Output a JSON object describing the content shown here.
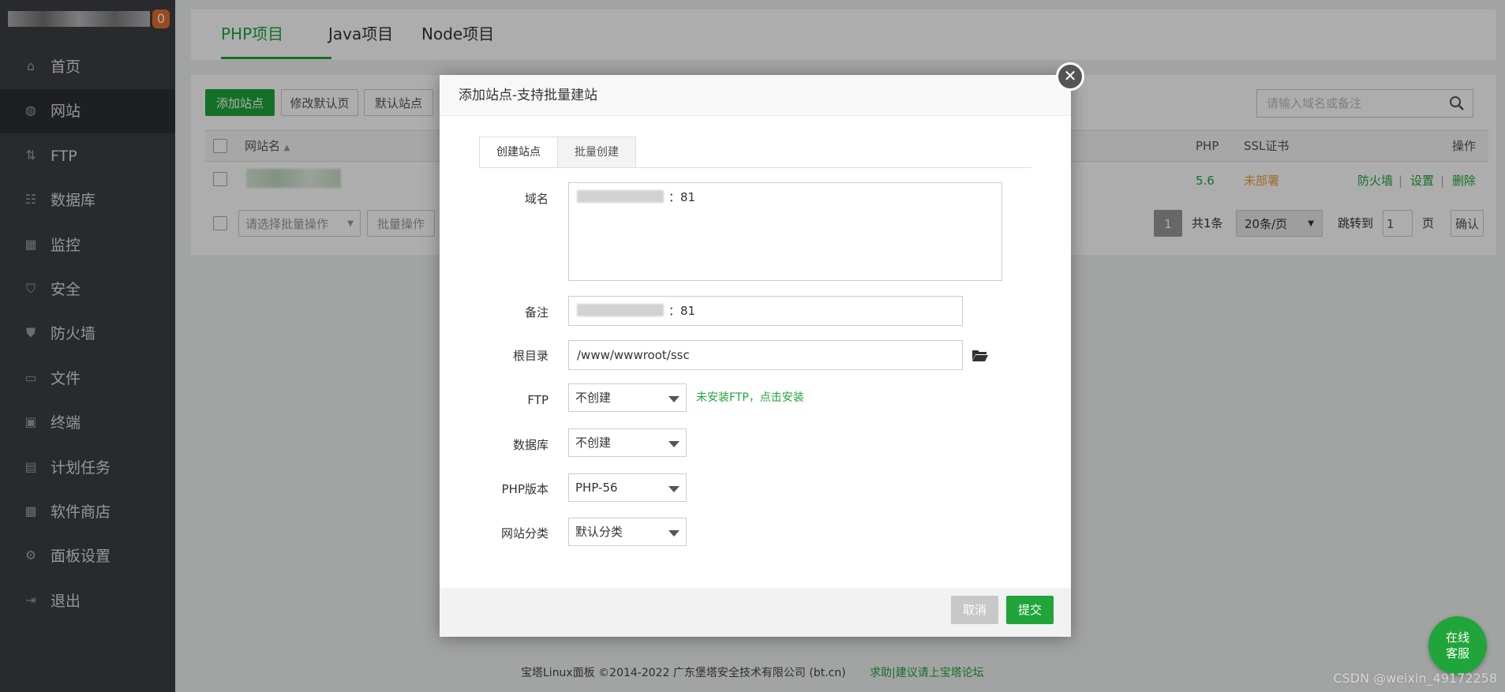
{
  "sidebar": {
    "badge": "0",
    "items": [
      {
        "label": "首页",
        "icon": "home-icon",
        "glyph": "⌂"
      },
      {
        "label": "网站",
        "icon": "globe-icon",
        "glyph": "◍"
      },
      {
        "label": "FTP",
        "icon": "ftp-icon",
        "glyph": "⇅"
      },
      {
        "label": "数据库",
        "icon": "database-icon",
        "glyph": "☷"
      },
      {
        "label": "监控",
        "icon": "monitor-icon",
        "glyph": "▦"
      },
      {
        "label": "安全",
        "icon": "shield-check-icon",
        "glyph": "⛉"
      },
      {
        "label": "防火墙",
        "icon": "firewall-icon",
        "glyph": "⛊"
      },
      {
        "label": "文件",
        "icon": "folder-icon",
        "glyph": "▭"
      },
      {
        "label": "终端",
        "icon": "terminal-icon",
        "glyph": "▣"
      },
      {
        "label": "计划任务",
        "icon": "calendar-icon",
        "glyph": "▤"
      },
      {
        "label": "软件商店",
        "icon": "apps-icon",
        "glyph": "▩"
      },
      {
        "label": "面板设置",
        "icon": "gear-icon",
        "glyph": "⚙"
      },
      {
        "label": "退出",
        "icon": "logout-icon",
        "glyph": "⇥"
      }
    ]
  },
  "project_tabs": [
    {
      "label": "PHP项目"
    },
    {
      "label": "Java项目"
    },
    {
      "label": "Node项目"
    }
  ],
  "toolbar": {
    "add_site": "添加站点",
    "edit_default_page": "修改默认页",
    "default_site": "默认站点",
    "search_placeholder": "请输入域名或备注"
  },
  "table": {
    "headers": {
      "name": "网站名",
      "php": "PHP",
      "ssl": "SSL证书",
      "actions": "操作"
    },
    "rows": [
      {
        "php": "5.6",
        "ssl": "未部署",
        "actions": [
          "防火墙",
          "设置",
          "删除"
        ],
        "sep": "|"
      }
    ]
  },
  "bulk": {
    "select_placeholder": "请选择批量操作",
    "apply": "批量操作"
  },
  "pagination": {
    "current": "1",
    "total": "共1条",
    "per_page": "20条/页",
    "jump_label": "跳转到",
    "jump_value": "1",
    "page_unit": "页",
    "confirm": "确认"
  },
  "modal": {
    "title": "添加站点-支持批量建站",
    "tabs": [
      "创建站点",
      "批量创建"
    ],
    "fields": {
      "domain_label": "域名",
      "domain_value": "：81",
      "note_label": "备注",
      "note_value": "：81",
      "root_label": "根目录",
      "root_value": "/www/wwwroot/ssc",
      "ftp_label": "FTP",
      "ftp_value": "不创建",
      "ftp_hint": "未安装FTP，点击安装",
      "db_label": "数据库",
      "db_value": "不创建",
      "php_label": "PHP版本",
      "php_value": "PHP-56",
      "category_label": "网站分类",
      "category_value": "默认分类"
    },
    "cancel": "取消",
    "submit": "提交"
  },
  "footer": {
    "copyright": "宝塔Linux面板 ©2014-2022 广东堡塔安全技术有限公司 (bt.cn)",
    "link": "求助|建议请上宝塔论坛"
  },
  "service": {
    "line1": "在线",
    "line2": "客服"
  },
  "watermark": "CSDN @weixin_49172258",
  "colors": {
    "accent": "#20a53a",
    "sidebar": "#3b3f45",
    "warning": "#e6a23c"
  }
}
